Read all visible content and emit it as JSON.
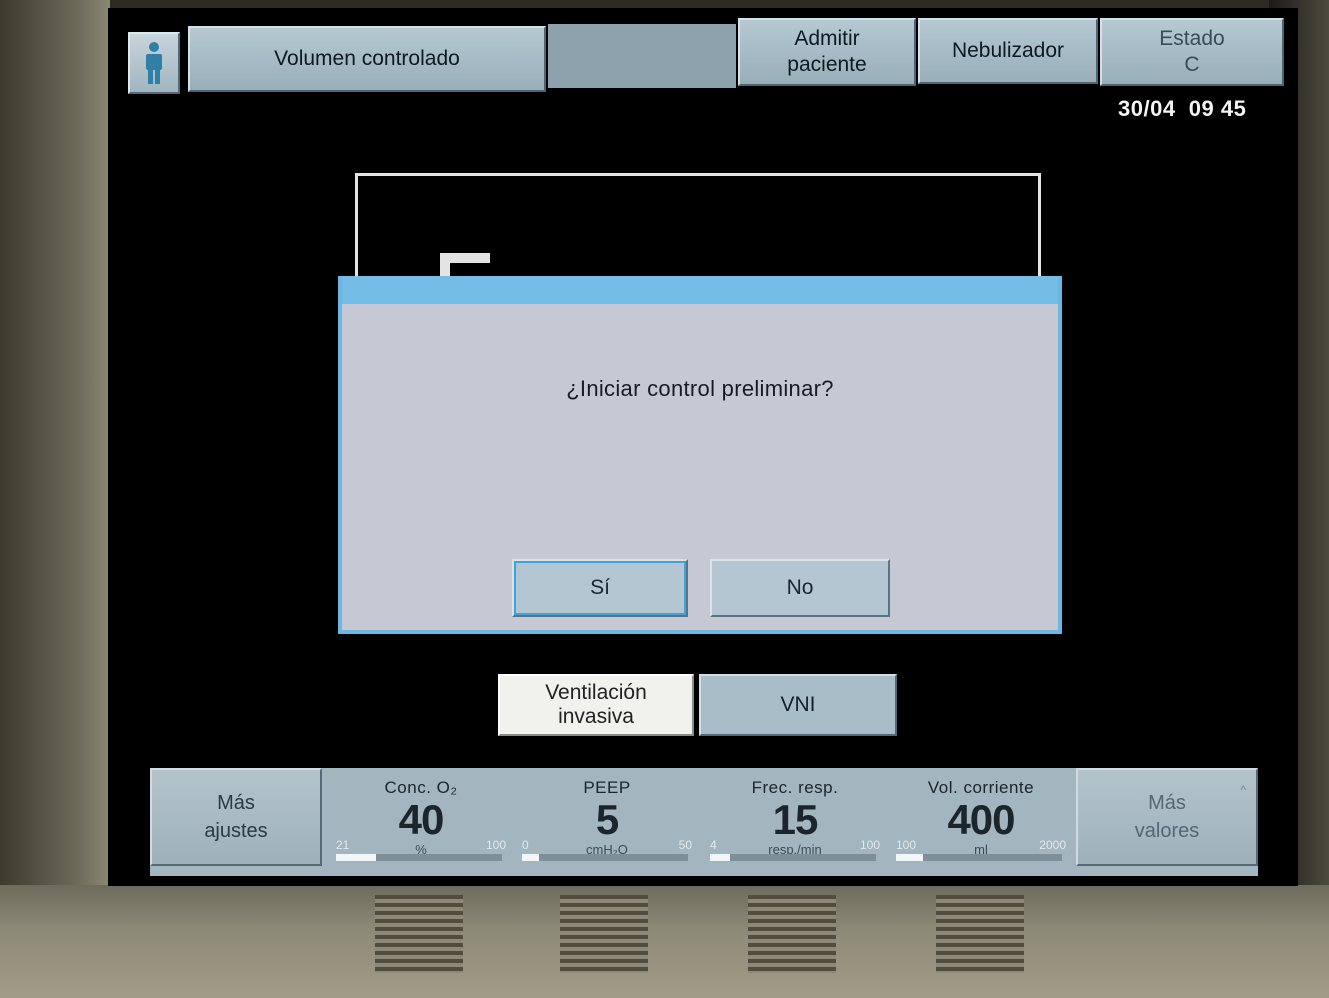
{
  "header": {
    "patient_icon": "person-icon",
    "mode_label": "Volumen controlado",
    "admit_label": "Admitir paciente",
    "nebulizer_label": "Nebulizador",
    "status_label": "Estado",
    "status_sub": "C",
    "date": "30/04",
    "time": "09 45"
  },
  "dialog": {
    "message": "¿Iniciar control preliminar?",
    "yes_label": "Sí",
    "no_label": "No"
  },
  "mode_select": {
    "invasive_label": "Ventilación invasiva",
    "vni_label": "VNI"
  },
  "bottom": {
    "more_settings_label": "Más ajustes",
    "more_values_label": "Más valores",
    "params": [
      {
        "label": "Conc. O₂",
        "value": "40",
        "unit": "%",
        "min": "21",
        "max": "100",
        "fill_fraction": 0.24
      },
      {
        "label": "PEEP",
        "value": "5",
        "unit": "cmH₂O",
        "min": "0",
        "max": "50",
        "fill_fraction": 0.1
      },
      {
        "label": "Frec. resp.",
        "value": "15",
        "unit": "resp./min",
        "min": "4",
        "max": "100",
        "fill_fraction": 0.12
      },
      {
        "label": "Vol. corriente",
        "value": "400",
        "unit": "ml",
        "min": "100",
        "max": "2000",
        "fill_fraction": 0.16
      }
    ]
  },
  "colors": {
    "dialog_accent": "#74bde6",
    "button_face": "#b3c6d2",
    "screen_background": "#000000"
  }
}
